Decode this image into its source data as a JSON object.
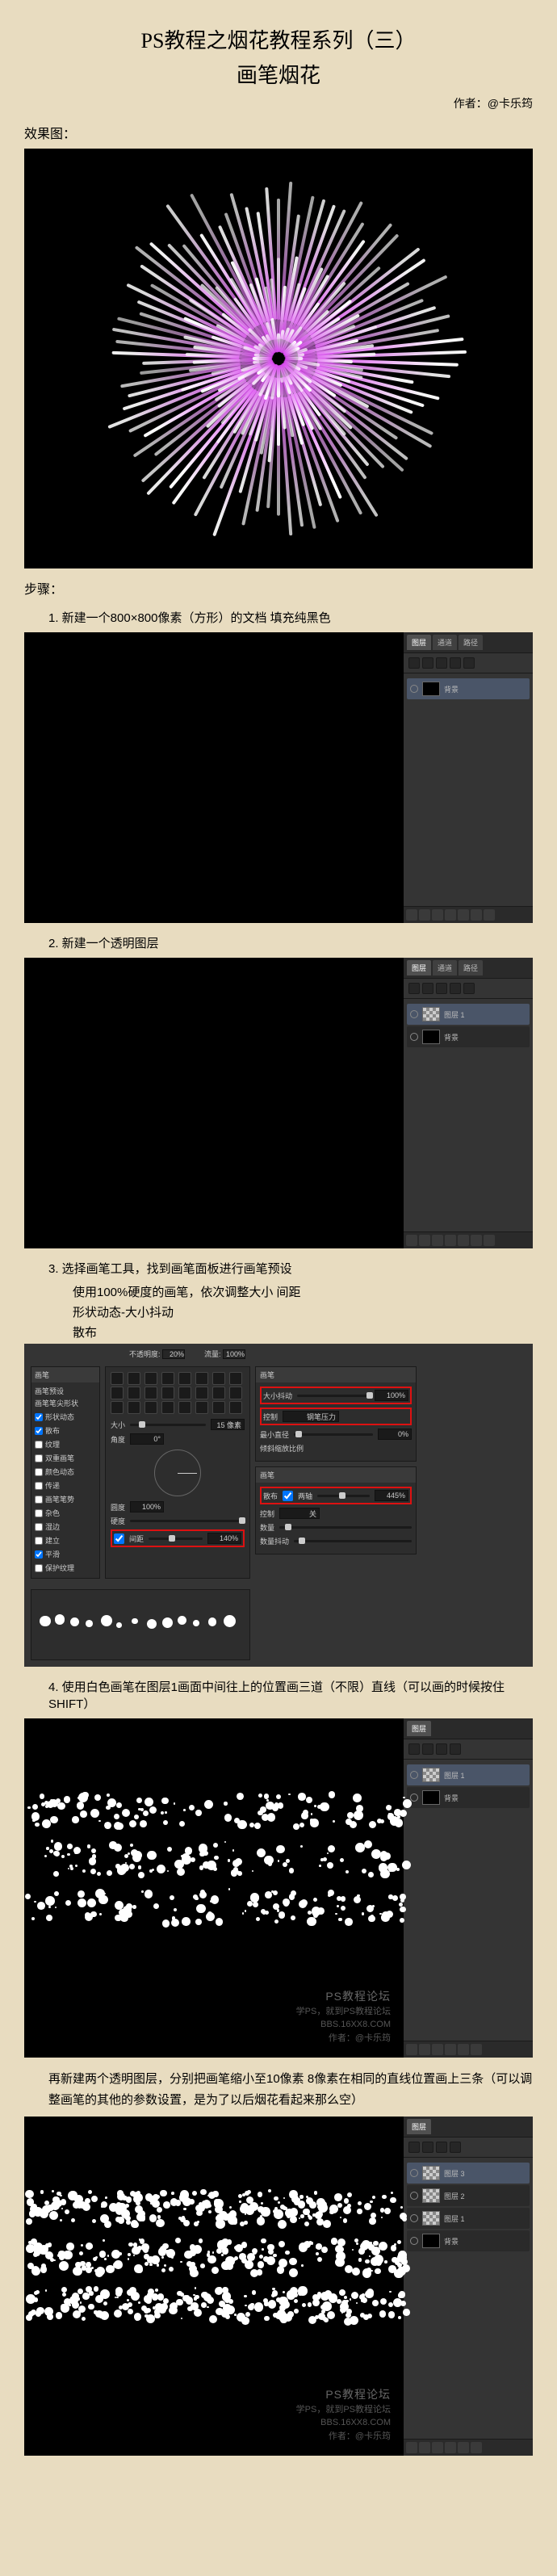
{
  "title_line1": "PS教程之烟花教程系列（三）",
  "title_line2": "画笔烟花",
  "author_label": "作者：@卡乐筠",
  "effect_label": "效果图：",
  "steps_label": "步骤：",
  "step1": "1. 新建一个800×800像素（方形）的文档 填充纯黑色",
  "step2": "2. 新建一个透明图层",
  "step3": "3. 选择画笔工具，找到画笔面板进行画笔预设",
  "step3_sub1": "使用100%硬度的画笔，依次调整大小 间距",
  "step3_sub2": "形状动态-大小抖动",
  "step3_sub3": "散布",
  "step4": "4. 使用白色画笔在图层1画面中间往上的位置画三道（不限）直线（可以画的时候按住SHIFT）",
  "para5": "再新建两个透明图层，分别把画笔缩小至10像素 8像素在相同的直线位置画上三条（可以调整画笔的其他的参数设置，是为了以后烟花看起来那么空）",
  "ps_panel": {
    "tab1": "图层",
    "tab2": "通道",
    "tab3": "路径",
    "layer_bg": "背景",
    "layer1": "图层 1",
    "layer2": "图层 2",
    "layer3": "图层 3"
  },
  "brush": {
    "tab": "画笔",
    "preset": "画笔预设",
    "tip": "画笔笔尖形状",
    "shape": "形状动态",
    "scatter": "散布",
    "texture": "纹理",
    "dual": "双重画笔",
    "color": "颜色动态",
    "transfer": "传递",
    "pose": "画笔笔势",
    "noise": "杂色",
    "wet": "湿边",
    "build": "建立",
    "smooth": "平滑",
    "protect": "保护纹理",
    "size_lbl": "大小",
    "size_val": "15 像素",
    "spacing_lbl": "间距",
    "spacing_val": "140%",
    "angle_lbl": "角度",
    "angle_val": "0°",
    "round_lbl": "圆度",
    "round_val": "100%",
    "hardness_lbl": "硬度",
    "opacity_lbl": "不透明度",
    "opacity_val": "20%",
    "flow_lbl": "流量",
    "flow_val": "100%",
    "jitter_lbl": "大小抖动",
    "jitter_val": "100%",
    "control_lbl": "控制",
    "control_val": "钢笔压力",
    "min_lbl": "最小直径",
    "min_val": "0%",
    "tilt_lbl": "倾斜缩放比例",
    "scatter_lbl": "散布",
    "scatter_val": "445%",
    "both_lbl": "两轴",
    "count_lbl": "数量",
    "count_jitter": "数量抖动",
    "control_off": "关"
  },
  "wm": {
    "line1": "PS教程论坛",
    "line2": "学PS，就到PS教程论坛",
    "line3": "BBS.16XX8.COM",
    "line4": "作者：@卡乐筠"
  }
}
